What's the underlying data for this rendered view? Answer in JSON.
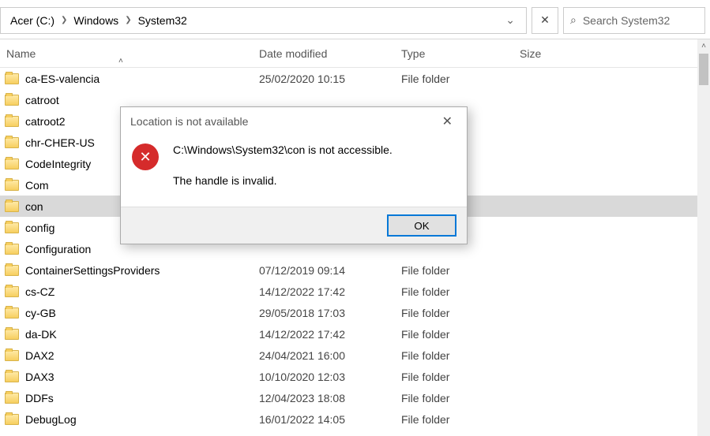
{
  "breadcrumb": {
    "a": "Acer (C:)",
    "b": "Windows",
    "c": "System32"
  },
  "search": {
    "placeholder": "Search System32"
  },
  "columns": {
    "name": "Name",
    "date": "Date modified",
    "type": "Type",
    "size": "Size"
  },
  "rows": [
    {
      "name": "ca-ES-valencia",
      "date": "25/02/2020 10:15",
      "type": "File folder",
      "selected": false
    },
    {
      "name": "catroot",
      "date": "",
      "type": "",
      "selected": false
    },
    {
      "name": "catroot2",
      "date": "",
      "type": "",
      "selected": false
    },
    {
      "name": "chr-CHER-US",
      "date": "",
      "type": "",
      "selected": false
    },
    {
      "name": "CodeIntegrity",
      "date": "",
      "type": "",
      "selected": false
    },
    {
      "name": "Com",
      "date": "",
      "type": "",
      "selected": false
    },
    {
      "name": "con",
      "date": "",
      "type": "",
      "selected": true
    },
    {
      "name": "config",
      "date": "",
      "type": "",
      "selected": false
    },
    {
      "name": "Configuration",
      "date": "",
      "type": "",
      "selected": false
    },
    {
      "name": "ContainerSettingsProviders",
      "date": "07/12/2019 09:14",
      "type": "File folder",
      "selected": false
    },
    {
      "name": "cs-CZ",
      "date": "14/12/2022 17:42",
      "type": "File folder",
      "selected": false
    },
    {
      "name": "cy-GB",
      "date": "29/05/2018 17:03",
      "type": "File folder",
      "selected": false
    },
    {
      "name": "da-DK",
      "date": "14/12/2022 17:42",
      "type": "File folder",
      "selected": false
    },
    {
      "name": "DAX2",
      "date": "24/04/2021 16:00",
      "type": "File folder",
      "selected": false
    },
    {
      "name": "DAX3",
      "date": "10/10/2020 12:03",
      "type": "File folder",
      "selected": false
    },
    {
      "name": "DDFs",
      "date": "12/04/2023 18:08",
      "type": "File folder",
      "selected": false
    },
    {
      "name": "DebugLog",
      "date": "16/01/2022 14:05",
      "type": "File folder",
      "selected": false
    }
  ],
  "dialog": {
    "title": "Location is not available",
    "line1": "C:\\Windows\\System32\\con is not accessible.",
    "line2": "The handle is invalid.",
    "ok": "OK"
  }
}
